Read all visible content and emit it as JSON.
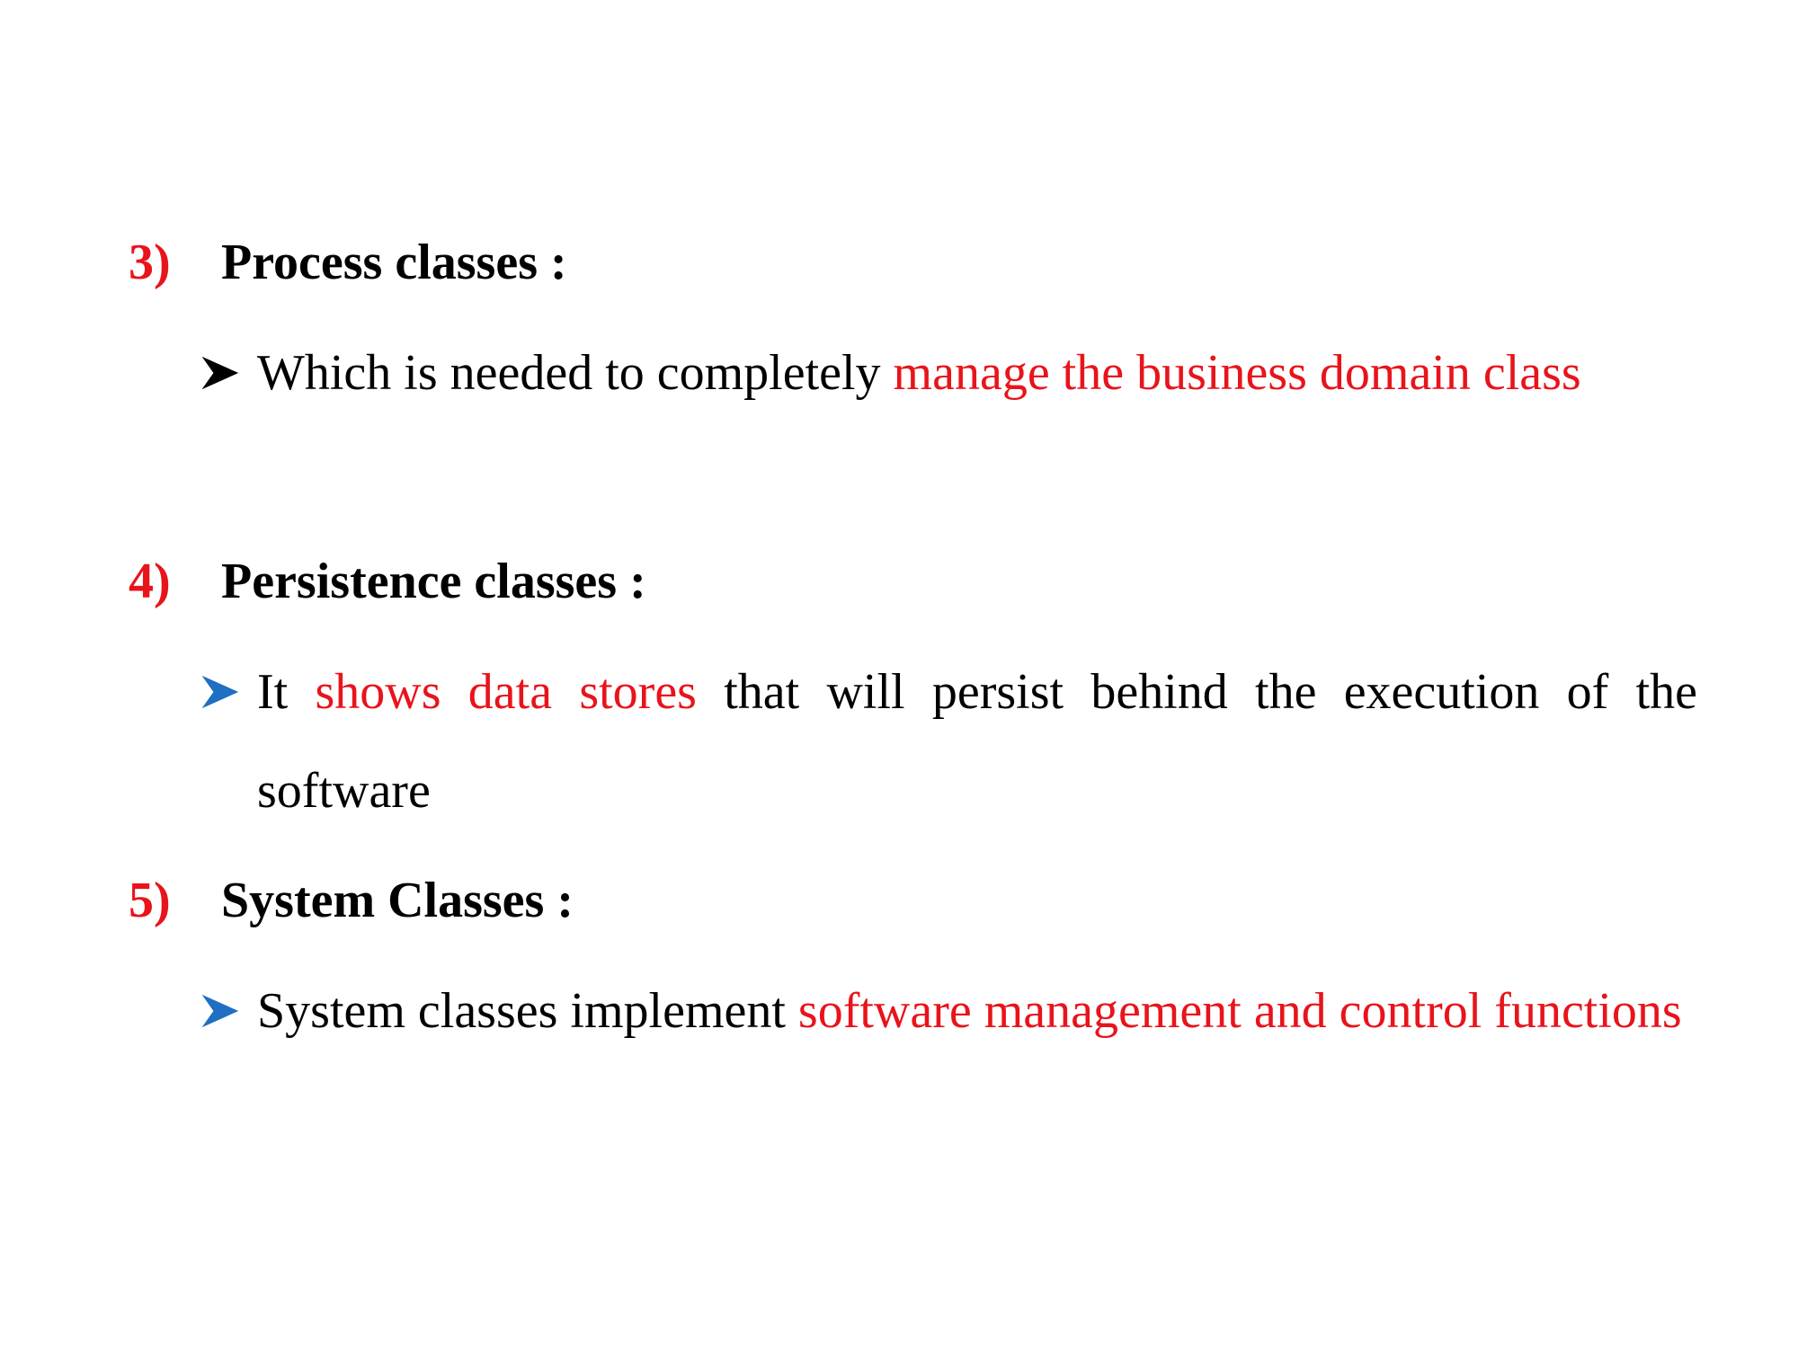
{
  "sections": [
    {
      "number": "3)",
      "title": "Process classes :",
      "bullet": {
        "arrow_color": "#000000",
        "parts": [
          {
            "text": "Which is needed to completely ",
            "highlight": false
          },
          {
            "text": "manage the business domain class",
            "highlight": true
          }
        ]
      }
    },
    {
      "number": "4)",
      "title": "Persistence classes :",
      "bullet": {
        "arrow_color": "#1f6fc2",
        "parts": [
          {
            "text": "It ",
            "highlight": false
          },
          {
            "text": "shows data stores",
            "highlight": true
          },
          {
            "text": " that will persist behind the execution of the software",
            "highlight": false
          }
        ]
      }
    },
    {
      "number": "5)",
      "title": "System Classes :",
      "bullet": {
        "arrow_color": "#1f6fc2",
        "parts": [
          {
            "text": "System classes implement ",
            "highlight": false
          },
          {
            "text": "software management and control functions",
            "highlight": true
          }
        ]
      }
    }
  ],
  "colors": {
    "highlight": "#e8141b",
    "text": "#000000",
    "arrow_black": "#000000",
    "arrow_blue": "#1f6fc2"
  },
  "icons": {
    "bullet": "arrowhead-bullet-icon"
  }
}
